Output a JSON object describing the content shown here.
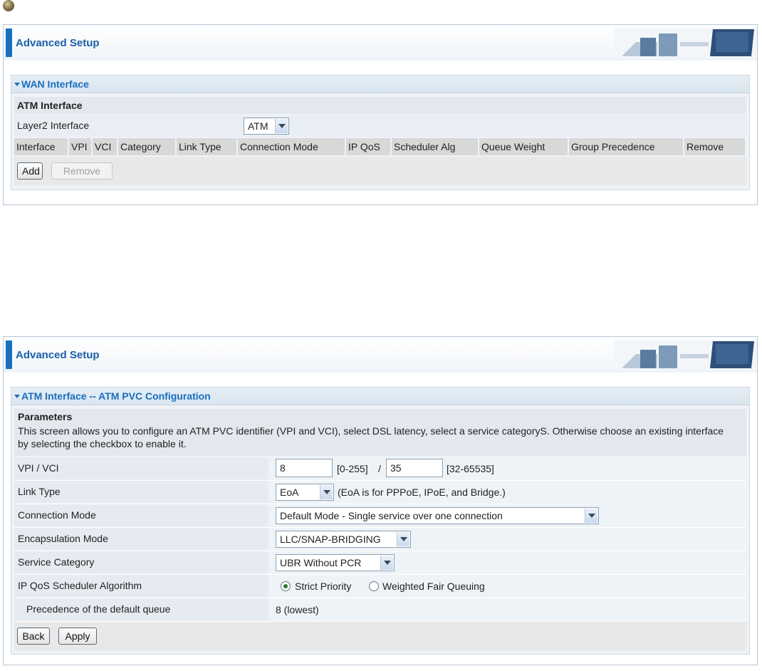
{
  "panel1": {
    "banner_title": "Advanced Setup",
    "section_title": "WAN Interface",
    "sub_title": "ATM Interface",
    "layer2_label": "Layer2 Interface",
    "layer2_value": "ATM",
    "columns": [
      "Interface",
      "VPI",
      "VCI",
      "Category",
      "Link Type",
      "Connection Mode",
      "IP QoS",
      "Scheduler Alg",
      "Queue Weight",
      "Group Precedence",
      "Remove"
    ],
    "add_label": "Add",
    "remove_label": "Remove"
  },
  "panel2": {
    "banner_title": "Advanced Setup",
    "section_title": "ATM Interface -- ATM PVC Configuration",
    "params_title": "Parameters",
    "description": "This screen allows you to configure an ATM PVC identifier (VPI and VCI), select DSL latency, select a service categoryS. Otherwise choose an existing interface by selecting the checkbox to enable it.",
    "vpi_vci_label": "VPI / VCI",
    "vpi_value": "8",
    "vpi_range": "[0-255]",
    "separator": "/",
    "vci_value": "35",
    "vci_range": "[32-65535]",
    "link_type_label": "Link Type",
    "link_type_value": "EoA",
    "link_type_note": "(EoA is for PPPoE, IPoE, and Bridge.)",
    "connection_mode_label": "Connection Mode",
    "connection_mode_value": "Default Mode - Single service over one connection",
    "encapsulation_label": "Encapsulation Mode",
    "encapsulation_value": "LLC/SNAP-BRIDGING",
    "service_category_label": "Service Category",
    "service_category_value": "UBR Without PCR",
    "scheduler_label": "IP QoS Scheduler Algorithm",
    "scheduler_option1": "Strict Priority",
    "scheduler_option2": "Weighted Fair Queuing",
    "scheduler_selected": "Strict Priority",
    "precedence_label": "Precedence of the default queue",
    "precedence_value": "8 (lowest)",
    "back_label": "Back",
    "apply_label": "Apply"
  }
}
